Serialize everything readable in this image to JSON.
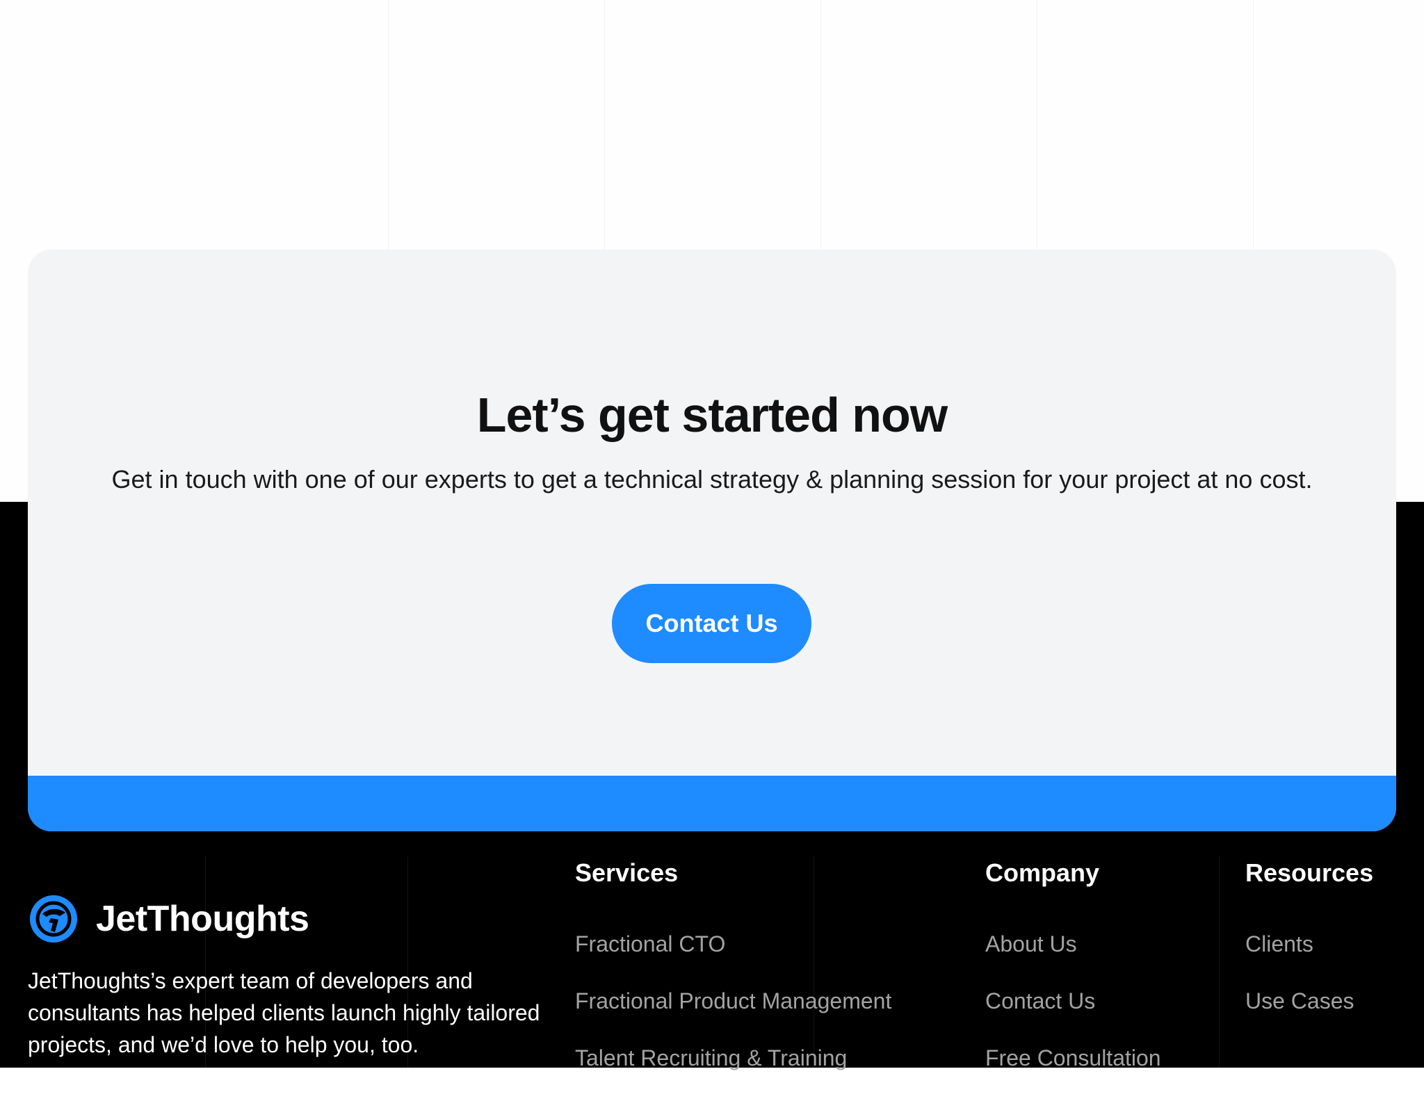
{
  "cta": {
    "title": "Let’s get started now",
    "subtitle": "Get in touch with one of our experts to get a technical strategy & planning session for your project at no cost.",
    "button_label": "Contact Us"
  },
  "brand": {
    "name": "JetThoughts",
    "logo_icon": "jetthoughts-logo-icon",
    "description": "JetThoughts’s expert team of developers and consultants has helped clients launch highly tailored projects, and we’d love to help you, too."
  },
  "footer": {
    "services": {
      "heading": "Services",
      "links": [
        "Fractional CTO",
        "Fractional Product Management",
        "Talent Recruiting & Training"
      ]
    },
    "company": {
      "heading": "Company",
      "links": [
        "About Us",
        "Contact Us",
        "Free Consultation"
      ]
    },
    "resources": {
      "heading": "Resources",
      "links": [
        "Clients",
        "Use Cases"
      ]
    }
  },
  "colors": {
    "accent": "#1e8bff",
    "card_bg": "#f3f4f6",
    "footer_bg": "#000000",
    "footer_link": "#a3a3a3"
  }
}
